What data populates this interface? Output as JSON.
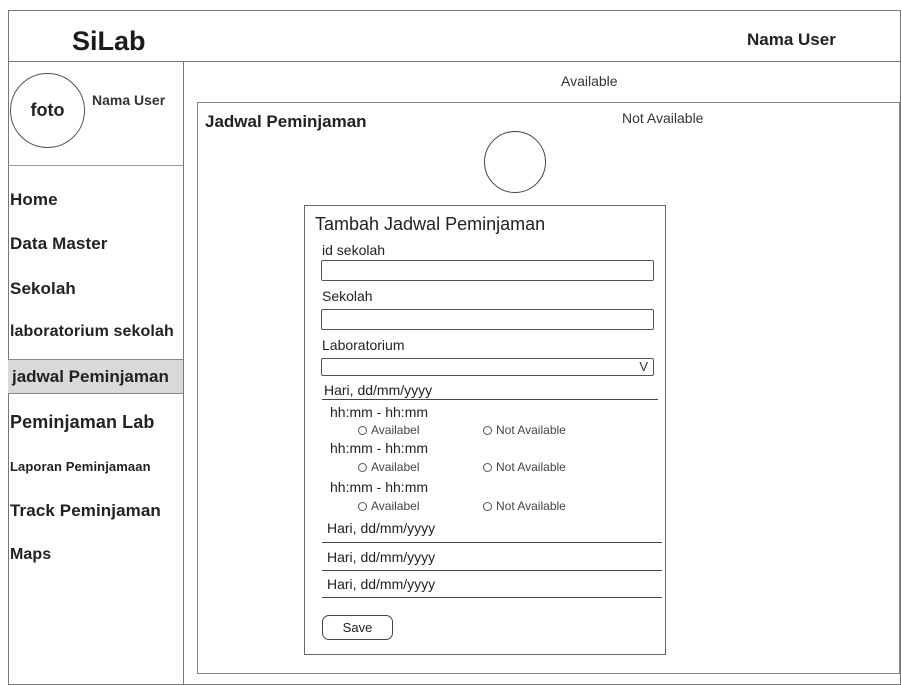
{
  "header": {
    "app_title": "SiLab",
    "user_name": "Nama User"
  },
  "sidebar": {
    "profile": {
      "photo_label": "foto",
      "user_name": "Nama User"
    },
    "items": [
      {
        "label": "Home"
      },
      {
        "label": "Data Master"
      },
      {
        "label": "Sekolah"
      },
      {
        "label": "laboratorium sekolah"
      },
      {
        "label": "jadwal Peminjaman"
      },
      {
        "label": "Peminjaman Lab"
      },
      {
        "label": "Laporan Peminjamaan"
      },
      {
        "label": "Track Peminjaman"
      },
      {
        "label": "Maps"
      }
    ]
  },
  "main": {
    "legend": {
      "available": "Available",
      "not_available": "Not Available"
    },
    "panel_title": "Jadwal Peminjaman"
  },
  "form": {
    "title": "Tambah Jadwal Peminjaman",
    "fields": {
      "id_sekolah": {
        "label": "id sekolah",
        "value": ""
      },
      "sekolah": {
        "label": "Sekolah",
        "value": ""
      },
      "laboratorium": {
        "label": "Laboratorium",
        "value": "",
        "chevron": "V"
      }
    },
    "days": [
      {
        "label": "Hari, dd/mm/yyyy",
        "slots": [
          {
            "time": "hh:mm - hh:mm",
            "opt_available": "Availabel",
            "opt_not_available": "Not Available"
          },
          {
            "time": "hh:mm - hh:mm",
            "opt_available": "Availabel",
            "opt_not_available": "Not Available"
          },
          {
            "time": "hh:mm - hh:mm",
            "opt_available": "Availabel",
            "opt_not_available": "Not Available"
          }
        ]
      },
      {
        "label": "Hari, dd/mm/yyyy"
      },
      {
        "label": "Hari, dd/mm/yyyy"
      },
      {
        "label": "Hari, dd/mm/yyyy"
      }
    ],
    "save_label": "Save"
  }
}
